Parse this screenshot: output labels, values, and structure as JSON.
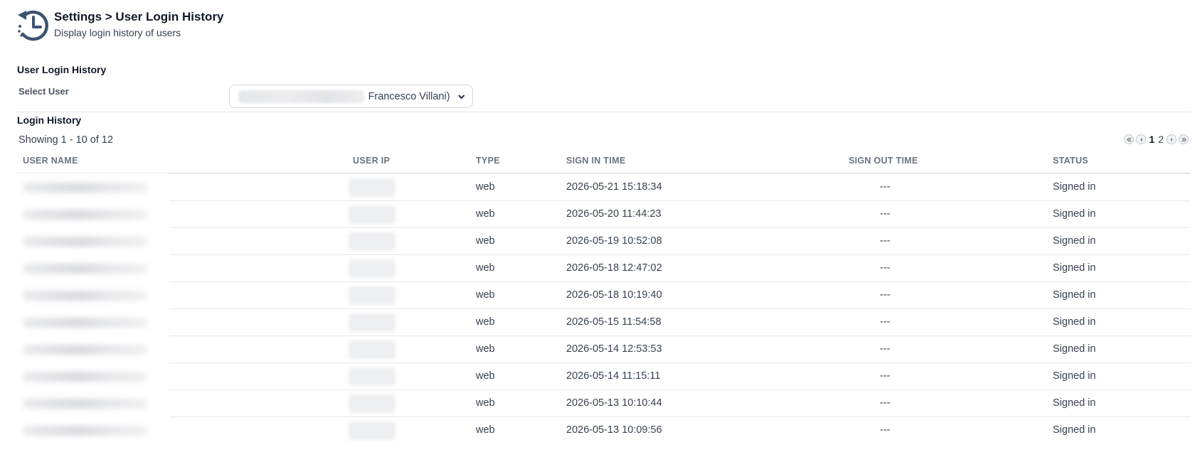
{
  "header": {
    "title": "Settings > User Login History",
    "subtitle": "Display login history of users",
    "icon": "history-clock-icon"
  },
  "user_section": {
    "title": "User Login History",
    "select_label": "Select User",
    "selected_value": "Francesco Villani)"
  },
  "history": {
    "title": "Login History",
    "showing": "Showing 1 - 10 of 12",
    "pagination": {
      "pages": [
        "1",
        "2"
      ],
      "current": "1"
    },
    "columns": [
      "USER NAME",
      "USER IP",
      "TYPE",
      "SIGN IN TIME",
      "SIGN OUT TIME",
      "STATUS"
    ],
    "rows": [
      {
        "type": "web",
        "sign_in": "2026-05-21 15:18:34",
        "sign_out": "---",
        "status": "Signed in"
      },
      {
        "type": "web",
        "sign_in": "2026-05-20 11:44:23",
        "sign_out": "---",
        "status": "Signed in"
      },
      {
        "type": "web",
        "sign_in": "2026-05-19 10:52:08",
        "sign_out": "---",
        "status": "Signed in"
      },
      {
        "type": "web",
        "sign_in": "2026-05-18 12:47:02",
        "sign_out": "---",
        "status": "Signed in"
      },
      {
        "type": "web",
        "sign_in": "2026-05-18 10:19:40",
        "sign_out": "---",
        "status": "Signed in"
      },
      {
        "type": "web",
        "sign_in": "2026-05-15 11:54:58",
        "sign_out": "---",
        "status": "Signed in"
      },
      {
        "type": "web",
        "sign_in": "2026-05-14 12:53:53",
        "sign_out": "---",
        "status": "Signed in"
      },
      {
        "type": "web",
        "sign_in": "2026-05-14 11:15:11",
        "sign_out": "---",
        "status": "Signed in"
      },
      {
        "type": "web",
        "sign_in": "2026-05-13 10:10:44",
        "sign_out": "---",
        "status": "Signed in"
      },
      {
        "type": "web",
        "sign_in": "2026-05-13 10:09:56",
        "sign_out": "---",
        "status": "Signed in"
      }
    ]
  },
  "colors": {
    "icon": "#3d5470",
    "border": "#e5e7eb",
    "header_text": "#6b7280"
  }
}
